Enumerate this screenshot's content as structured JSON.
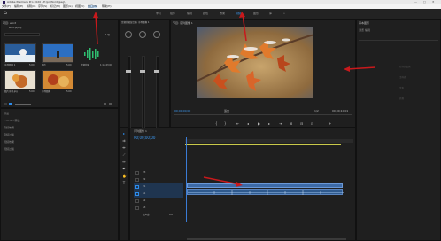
{
  "app": {
    "title": "Adobe Premiere Pro 2020 - E:\\pr\\Word\\jpeg\\",
    "menu": [
      "文件(F)",
      "编辑(E)",
      "剪辑(C)",
      "序列(S)",
      "标记(M)",
      "图形(G)",
      "视图(V)",
      "窗口(W)",
      "帮助(H)"
    ],
    "home_icon": "home-icon",
    "workspaces": [
      "学习",
      "组件",
      "编辑",
      "颜色",
      "效果",
      "音频",
      "图形",
      "库"
    ],
    "active_workspace": "效果"
  },
  "project": {
    "title": "项目: word",
    "file": "word.prproj",
    "count": "1 项",
    "items": [
      {
        "label": "序列图像 1",
        "dur": "5:00"
      },
      {
        "label": "图片",
        "dur": "5:00"
      },
      {
        "label": "音频剪辑",
        "dur": "1:15:23:00"
      },
      {
        "label": "图片序列.jpg",
        "dur": "5:00"
      },
      {
        "label": "序列图像",
        "dur": "5:00"
      }
    ]
  },
  "effects_list": [
    "预设",
    "Lumetri 预设",
    "音频效果",
    "音频过渡",
    "视频效果",
    "视频过渡"
  ],
  "audio_mixer": {
    "title": "音频剪辑混合器: 序列图像 1"
  },
  "program": {
    "title": "节目: 序列图像 1",
    "timecode_left": "00;00;00;00",
    "fit": "适合",
    "ratio": "1/2",
    "timecode_right": "00;00;10;01"
  },
  "effect_controls": {
    "title": "基本图形",
    "subtitle": "浏览  编辑",
    "labels": [
      "对齐并变换",
      "主样式",
      "文本",
      "外观"
    ]
  },
  "timeline": {
    "title": "序列图像 1",
    "timecode": "00;00;00;00",
    "tracks": [
      "V3",
      "V2",
      "V1",
      "A1",
      "A2",
      "A3"
    ],
    "master": "主声道",
    "master_value": "0.0"
  },
  "colors": {
    "accent": "#2d8ceb",
    "playhead": "#3a7bd5",
    "arrow": "#c8191c"
  }
}
